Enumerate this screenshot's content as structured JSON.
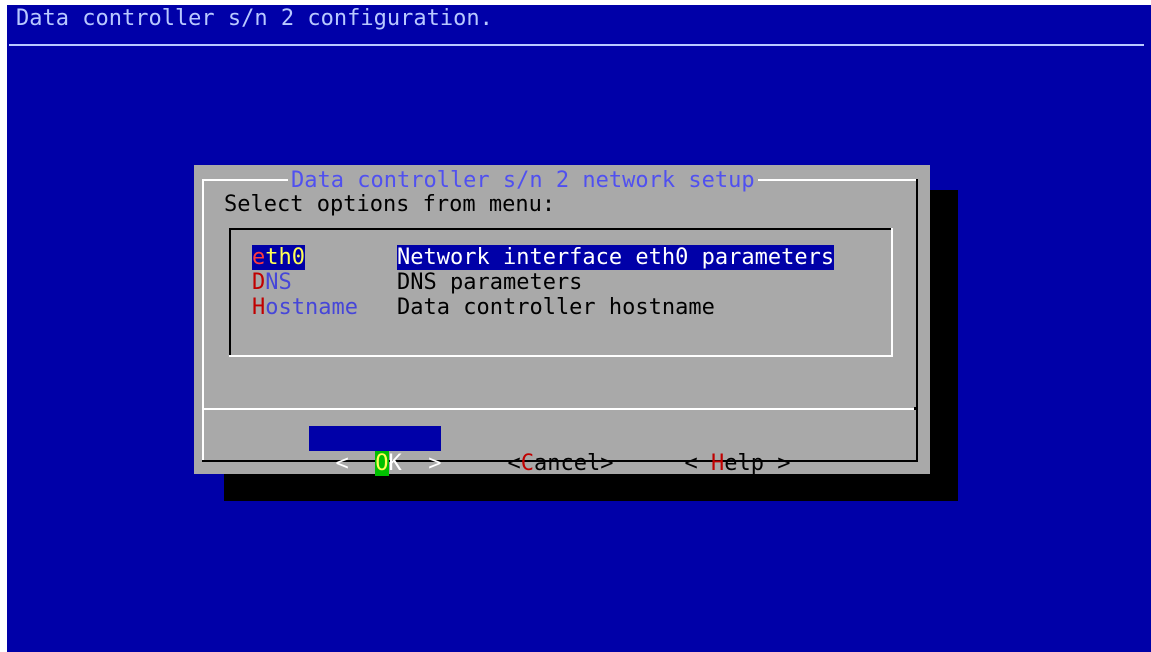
{
  "backtitle": "Data controller s/n 2 configuration.",
  "dialog": {
    "title": "Data controller s/n 2 network setup",
    "prompt": "Select options from menu:"
  },
  "menu": [
    {
      "tag_hot": "e",
      "tag_rest": "th0",
      "description": "Network interface eth0 parameters",
      "selected": true
    },
    {
      "tag_hot": "D",
      "tag_rest": "NS",
      "description": "DNS parameters",
      "selected": false
    },
    {
      "tag_hot": "H",
      "tag_rest": "ostname",
      "description": "Data controller hostname",
      "selected": false
    }
  ],
  "buttons": {
    "ok": {
      "left": "<  ",
      "key": "O",
      "rest": "K  >"
    },
    "cancel": {
      "left": "<",
      "key": "C",
      "rest": "ancel>"
    },
    "help": {
      "left": "< ",
      "key": "H",
      "rest": "elp >"
    }
  },
  "colors": {
    "screen_background": "#0000a8",
    "dialog_background": "#a9a9a9",
    "highlight": "#0000a8",
    "hotkey": "#c00000"
  }
}
